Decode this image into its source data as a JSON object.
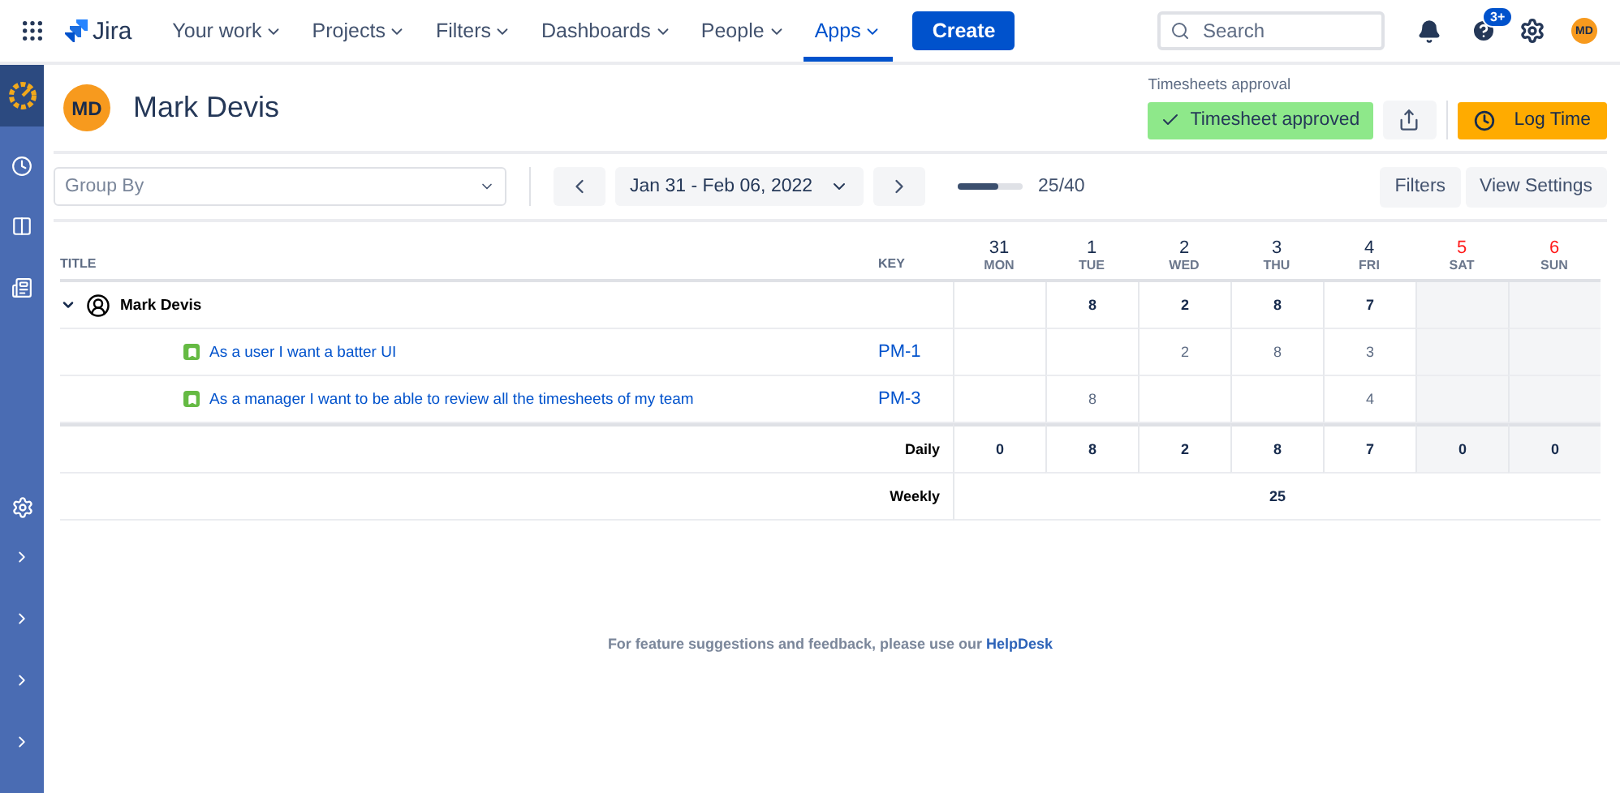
{
  "nav": {
    "product": "Jira",
    "items": [
      {
        "label": "Your work",
        "selected": false
      },
      {
        "label": "Projects",
        "selected": false
      },
      {
        "label": "Filters",
        "selected": false
      },
      {
        "label": "Dashboards",
        "selected": false
      },
      {
        "label": "People",
        "selected": false
      },
      {
        "label": "Apps",
        "selected": true
      }
    ],
    "create": "Create",
    "search": {
      "placeholder": "Search"
    },
    "help_badge": "3+",
    "user_initials": "MD"
  },
  "header": {
    "user": {
      "initials": "MD",
      "name": "Mark Devis"
    },
    "approval": {
      "label": "Timesheets approval",
      "status": "Timesheet approved",
      "approved": true
    },
    "log_time": "Log Time"
  },
  "toolbar": {
    "group_by": {
      "placeholder": "Group By"
    },
    "date_range": "Jan 31 - Feb 06, 2022",
    "progress": {
      "level": 0.625,
      "reading": "25/40"
    },
    "buttons": [
      "Filters",
      "View Settings"
    ]
  },
  "table": {
    "columns": {
      "title": "TITLE",
      "key": "KEY"
    },
    "days": [
      {
        "date": "31",
        "day": "MON",
        "weekend": false
      },
      {
        "date": "1",
        "day": "TUE",
        "weekend": false
      },
      {
        "date": "2",
        "day": "WED",
        "weekend": false
      },
      {
        "date": "3",
        "day": "THU",
        "weekend": false
      },
      {
        "date": "4",
        "day": "FRI",
        "weekend": false
      },
      {
        "date": "5",
        "day": "SAT",
        "weekend": true
      },
      {
        "date": "6",
        "day": "SUN",
        "weekend": true
      }
    ],
    "groups": [
      {
        "name": "Mark Devis",
        "expanded": true,
        "totals": [
          {
            "kind": "empty"
          },
          {
            "kind": "hours",
            "value": "8"
          },
          {
            "kind": "hours",
            "value": "2"
          },
          {
            "kind": "hours",
            "value": "8"
          },
          {
            "kind": "hours",
            "value": "7"
          },
          {
            "kind": "empty"
          },
          {
            "kind": "empty"
          }
        ],
        "rows": [
          {
            "title": "As a user I want a batter UI",
            "key": "PM-1",
            "hours": [
              {
                "kind": "empty"
              },
              {
                "kind": "empty"
              },
              {
                "kind": "hours",
                "value": "2"
              },
              {
                "kind": "hours",
                "value": "8"
              },
              {
                "kind": "hours",
                "value": "3"
              },
              {
                "kind": "empty"
              },
              {
                "kind": "empty"
              }
            ]
          },
          {
            "title": "As a manager I want to be able to review all the timesheets of my team",
            "key": "PM-3",
            "hours": [
              {
                "kind": "empty"
              },
              {
                "kind": "hours",
                "value": "8"
              },
              {
                "kind": "empty"
              },
              {
                "kind": "empty"
              },
              {
                "kind": "hours",
                "value": "4"
              },
              {
                "kind": "empty"
              },
              {
                "kind": "empty"
              }
            ]
          }
        ]
      }
    ],
    "daily": {
      "label": "Daily",
      "values": [
        "0",
        "8",
        "2",
        "8",
        "7",
        "0",
        "0"
      ]
    },
    "weekly": {
      "label": "Weekly",
      "value": "25"
    }
  },
  "footer": {
    "text": "For feature suggestions and feedback, please use our",
    "link": "HelpDesk"
  }
}
